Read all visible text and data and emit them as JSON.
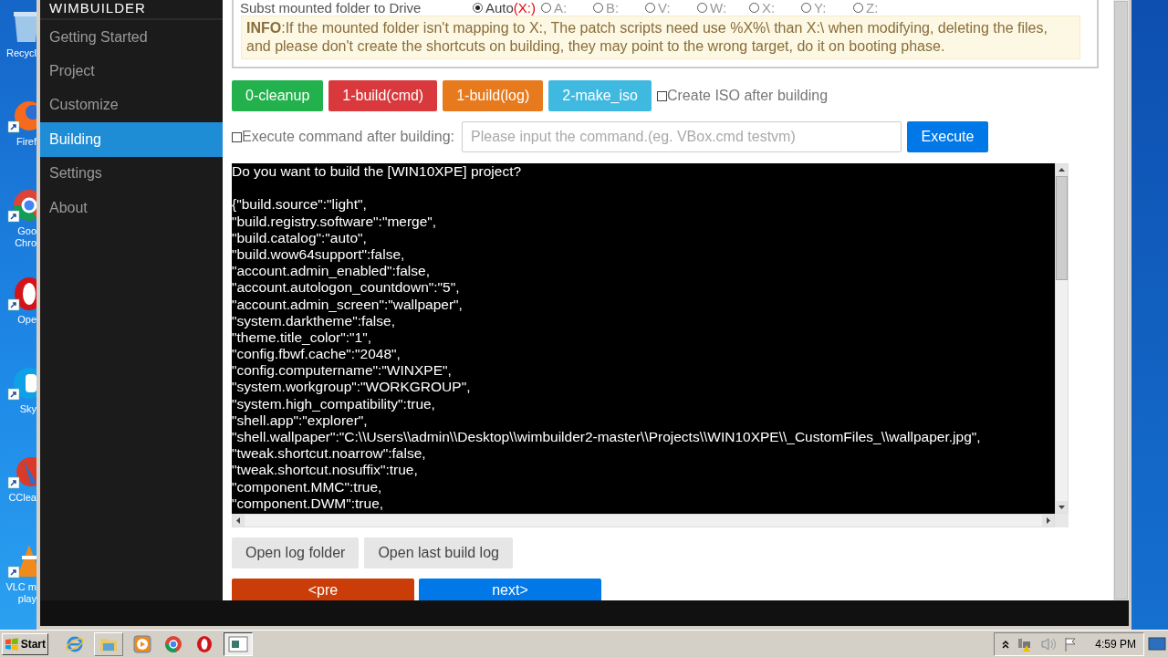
{
  "desktop_icons": [
    {
      "kind": "recycle",
      "lines": [
        "Recycl"
      ]
    },
    {
      "kind": "firefox",
      "lines": [
        "Firef"
      ]
    },
    {
      "kind": "chrome",
      "lines": [
        "Goo",
        "Chro"
      ]
    },
    {
      "kind": "opera",
      "lines": [
        "Ope"
      ]
    },
    {
      "kind": "skype",
      "lines": [
        "Sky"
      ]
    },
    {
      "kind": "ccleaner",
      "lines": [
        "CClea"
      ]
    },
    {
      "kind": "vlc",
      "lines": [
        "VLC m",
        "play"
      ]
    }
  ],
  "sidebar": {
    "title": "WIMBUILDER",
    "items": [
      {
        "label": "Getting Started",
        "selected": false
      },
      {
        "label": "Project",
        "selected": false
      },
      {
        "label": "Customize",
        "selected": false
      },
      {
        "label": "Building",
        "selected": true
      },
      {
        "label": "Settings",
        "selected": false
      },
      {
        "label": "About",
        "selected": false
      }
    ]
  },
  "drive_option": {
    "label": "Subst mounted folder to Drive",
    "options": [
      {
        "label": "Auto",
        "suffix": "(X:)",
        "selected": true
      },
      {
        "label": "A:",
        "selected": false
      },
      {
        "label": "B:",
        "selected": false
      },
      {
        "label": "V:",
        "selected": false
      },
      {
        "label": "W:",
        "selected": false
      },
      {
        "label": "X:",
        "selected": false
      },
      {
        "label": "Y:",
        "selected": false
      },
      {
        "label": "Z:",
        "selected": false
      }
    ]
  },
  "info": "**INFO**:If the mounted folder isn't mapping to X:, The patch scripts need use %X%\\ than X:\\ when modifying, deleting the files, and please don't create the shortcuts on building, they may point to the wrong target, do it on booting phase.",
  "build_buttons": [
    {
      "label": "0-cleanup",
      "color": "#22b14c"
    },
    {
      "label": "1-build(cmd)",
      "color": "#d9393c"
    },
    {
      "label": "1-build(log)",
      "color": "#e87a1e"
    },
    {
      "label": "2-make_iso",
      "color": "#40b9e0"
    }
  ],
  "create_iso": {
    "label": "Create ISO after building",
    "checked": false
  },
  "execute_command": {
    "label": "Execute command after building:",
    "checked": false,
    "placeholder": "Please input the command.(eg. VBox.cmd testvm)",
    "button": "Execute"
  },
  "console": {
    "paragraphs": [
      [
        "Do you want to build the [WIN10XPE] project?"
      ],
      [
        "{\"build.source\":\"light\",",
        "\"build.registry.software\":\"merge\",",
        "\"build.catalog\":\"auto\",",
        "\"build.wow64support\":false,",
        "\"account.admin_enabled\":false,",
        "\"account.autologon_countdown\":\"5\",",
        "\"account.admin_screen\":\"wallpaper\",",
        "\"system.darktheme\":false,",
        "\"theme.title_color\":\"1\",",
        "\"config.fbwf.cache\":\"2048\",",
        "\"config.computername\":\"WINXPE\",",
        "\"system.workgroup\":\"WORKGROUP\",",
        "\"system.high_compatibility\":true,",
        "\"shell.app\":\"explorer\",",
        "\"shell.wallpaper\":\"C:\\\\Users\\\\admin\\\\Desktop\\\\wimbuilder2-master\\\\Projects\\\\WIN10XPE\\\\_CustomFiles_\\\\wallpaper.jpg\",",
        "\"tweak.shortcut.noarrow\":false,",
        "\"tweak.shortcut.nosuffix\":true,",
        "\"component.MMC\":true,",
        "\"component.DWM\":true,"
      ]
    ]
  },
  "log_buttons": [
    "Open log folder",
    "Open last build log"
  ],
  "nav_buttons": [
    {
      "label": "<pre",
      "kind": "prev"
    },
    {
      "label": "next>",
      "kind": "next"
    }
  ],
  "taskbar": {
    "start": "Start",
    "apps": [
      {
        "kind": "ie"
      },
      {
        "kind": "folder"
      },
      {
        "kind": "media"
      },
      {
        "kind": "chrome"
      },
      {
        "kind": "opera"
      },
      {
        "kind": "window"
      }
    ],
    "clock": "4:59 PM"
  }
}
